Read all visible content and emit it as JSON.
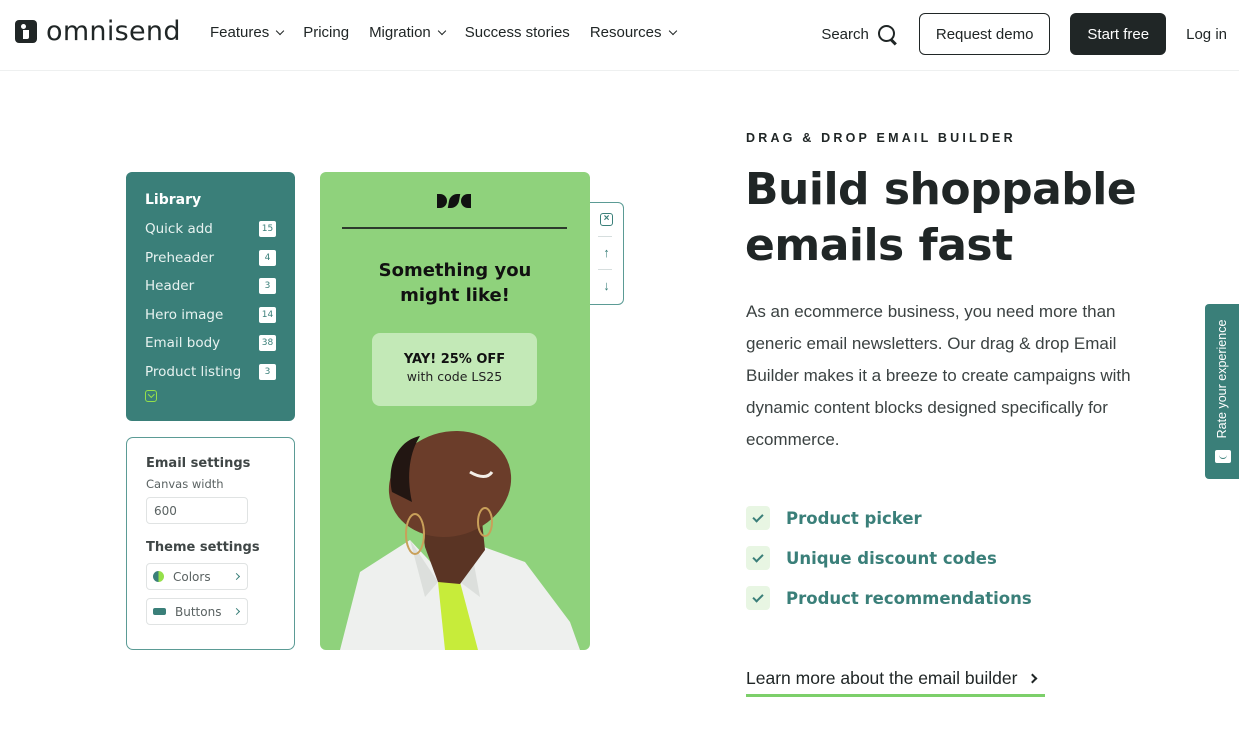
{
  "nav": {
    "logo_text": "omnisend",
    "links": [
      {
        "label": "Features",
        "dropdown": true
      },
      {
        "label": "Pricing",
        "dropdown": false
      },
      {
        "label": "Migration",
        "dropdown": true
      },
      {
        "label": "Success stories",
        "dropdown": false
      },
      {
        "label": "Resources",
        "dropdown": true
      }
    ],
    "search_label": "Search",
    "request_demo_label": "Request demo",
    "start_free_label": "Start free",
    "login_label": "Log in"
  },
  "library": {
    "title": "Library",
    "items": [
      {
        "label": "Quick add",
        "count": "15"
      },
      {
        "label": "Preheader",
        "count": "4"
      },
      {
        "label": "Header",
        "count": "3"
      },
      {
        "label": "Hero image",
        "count": "14"
      },
      {
        "label": "Email body",
        "count": "38"
      },
      {
        "label": "Product listing",
        "count": "3"
      }
    ]
  },
  "settings": {
    "email_title": "Email settings",
    "canvas_label": "Canvas width",
    "canvas_value": "600",
    "theme_title": "Theme settings",
    "options": [
      {
        "label": "Colors",
        "icon": "color-swatch-icon"
      },
      {
        "label": "Buttons",
        "icon": "button-shape-icon"
      }
    ]
  },
  "email_preview": {
    "headline_line1": "Something you",
    "headline_line2": "might like!",
    "coupon_title": "YAY! 25% OFF",
    "coupon_sub": "with code LS25",
    "background": "#8fd27c"
  },
  "block_toolbar": {
    "icons": [
      "close-icon",
      "arrow-up-icon",
      "arrow-down-icon"
    ],
    "close": "×",
    "up": "↑",
    "down": "↓"
  },
  "hero": {
    "eyebrow": "DRAG & DROP EMAIL BUILDER",
    "headline_line1": "Build shoppable",
    "headline_line2": "emails fast",
    "body": "As an ecommerce business, you need more than generic email newsletters. Our drag & drop Email Builder makes it a breeze to create campaigns with dynamic content blocks designed specifically for ecommerce.",
    "features": [
      "Product picker",
      "Unique discount codes",
      "Product recommendations"
    ],
    "cta_label": "Learn more about the email builder"
  },
  "feedback_tab": {
    "label": "Rate your experience"
  },
  "colors": {
    "brand_teal": "#3a7f79",
    "brand_green": "#7ccf6a",
    "dark": "#202626"
  }
}
